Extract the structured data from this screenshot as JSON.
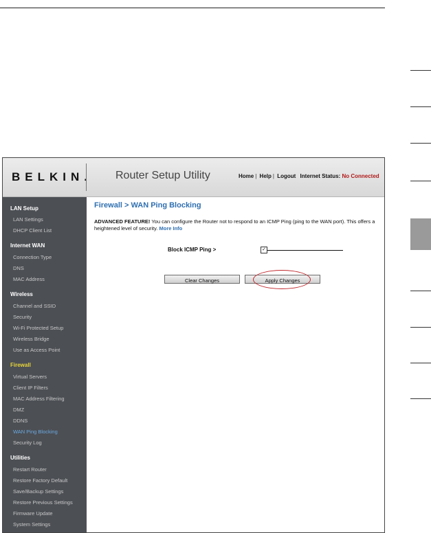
{
  "header": {
    "logo": "BELKIN.",
    "app_title": "Router Setup Utility",
    "links": [
      "Home",
      "Help",
      "Logout"
    ],
    "status_label": "Internet Status:",
    "status_value": "No Connected",
    "status_color": "#b11a1a"
  },
  "sidebar": {
    "sections": [
      {
        "title": "LAN Setup",
        "items": [
          "LAN Settings",
          "DHCP Client List"
        ]
      },
      {
        "title": "Internet WAN",
        "items": [
          "Connection Type",
          "DNS",
          "MAC Address"
        ]
      },
      {
        "title": "Wireless",
        "items": [
          "Channel and SSID",
          "Security",
          "Wi-Fi Protected Setup",
          "Wireless Bridge",
          "Use as Access Point"
        ]
      },
      {
        "title": "Firewall",
        "items": [
          "Virtual Servers",
          "Client IP Filters",
          "MAC Address Filtering",
          "DMZ",
          "DDNS",
          "WAN Ping Blocking",
          "Security Log"
        ]
      },
      {
        "title": "Utilities",
        "items": [
          "Restart Router",
          "Restore Factory Default",
          "Save/Backup Settings",
          "Restore Previous Settings",
          "Firmware Update",
          "System Settings"
        ]
      }
    ],
    "active_section": "Firewall",
    "current_item": "WAN Ping Blocking"
  },
  "main": {
    "title": "Firewall > WAN Ping Blocking",
    "desc_lead": "ADVANCED FEATURE!",
    "desc_body": " You can configure the Router not to respond to an ICMP Ping (ping to the WAN port). This offers a heightened level of security. ",
    "more_info": "More Info",
    "field_label": "Block ICMP Ping >",
    "checkbox_checked": true,
    "checkbox_mark": "✓",
    "clear_button": "Clear Changes",
    "apply_button": "Apply Changes"
  },
  "colors": {
    "accent": "#2f6fb0",
    "sidebar_bg": "#4c4f54",
    "active_section": "#e8d63a",
    "highlight": "#c0262b"
  }
}
